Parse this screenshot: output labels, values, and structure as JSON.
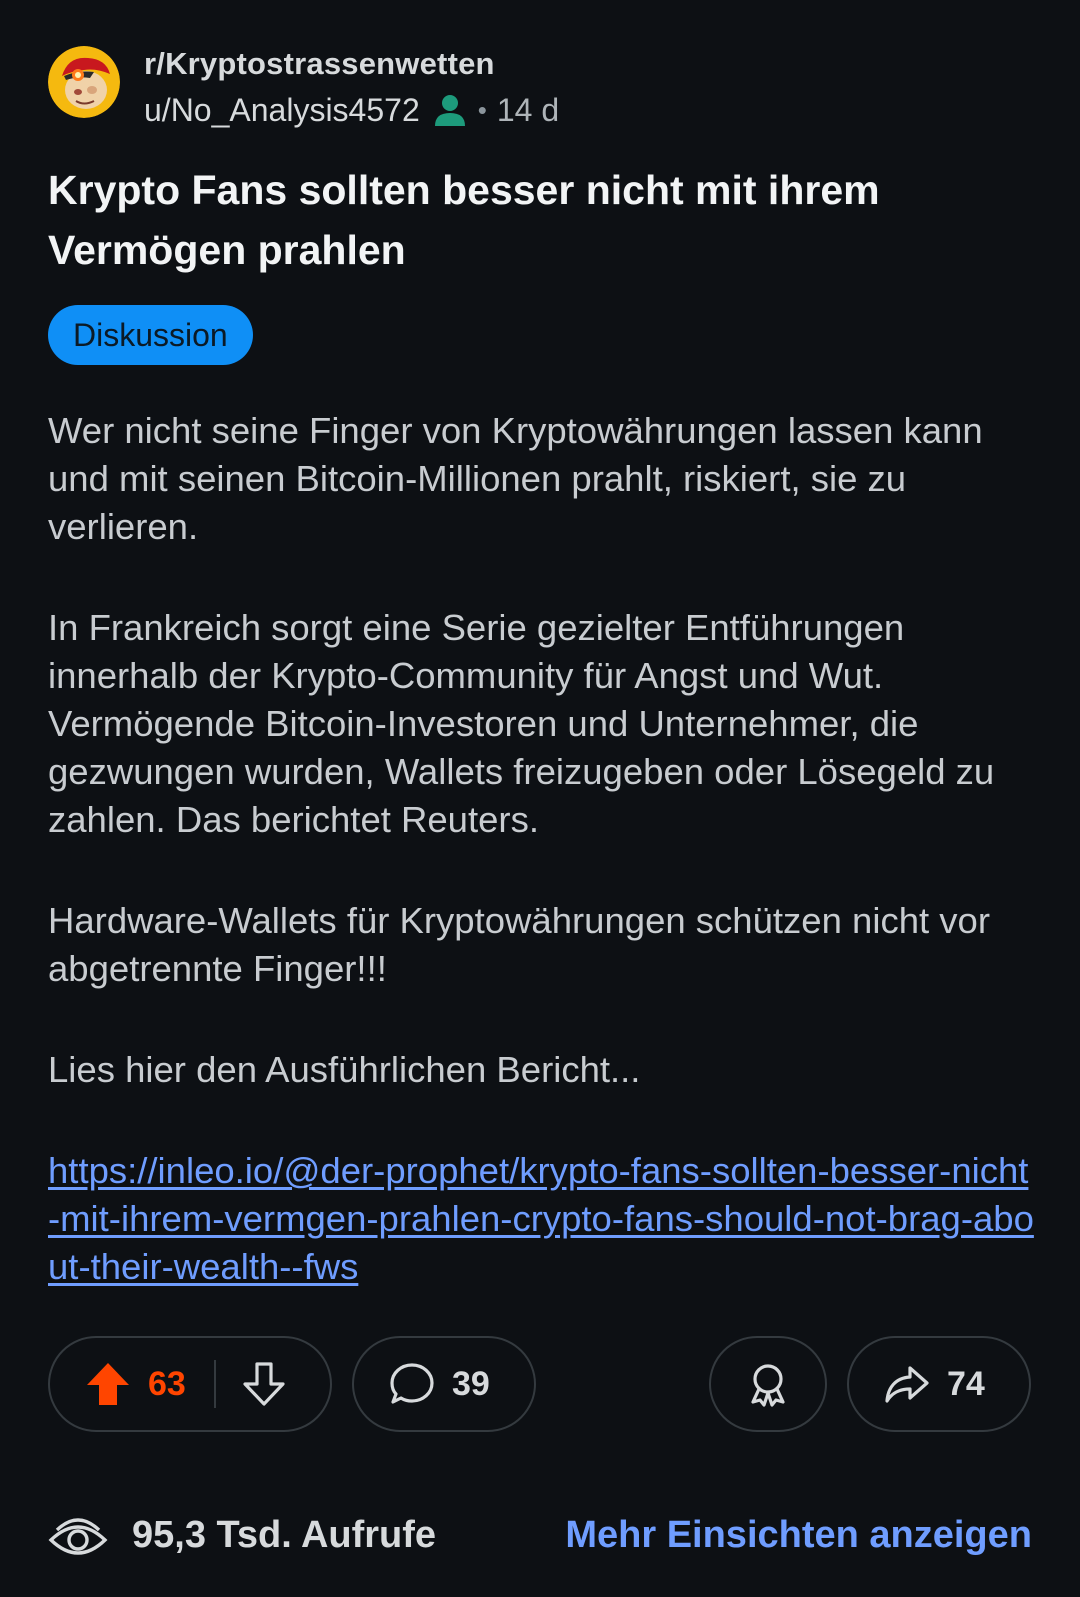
{
  "header": {
    "subreddit": "r/Kryptostrassenwetten",
    "username": "u/No_Analysis4572",
    "user_icon": "person-icon",
    "separator": "•",
    "age": "14 d"
  },
  "post": {
    "title": "Krypto Fans sollten besser nicht mit ihrem Vermögen prahlen",
    "flair": "Diskussion",
    "paragraphs": [
      "Wer nicht seine Finger von Kryptowährungen lassen kann und mit seinen Bitcoin-Millionen prahlt, riskiert, sie zu verlieren.",
      "In Frankreich sorgt eine Serie gezielter Entführungen innerhalb der Krypto-Community für Angst und Wut. Vermögende Bitcoin-Investoren und Unternehmer, die gezwungen wurden, Wallets freizugeben oder Lösegeld zu zahlen. Das berichtet Reuters.",
      "Hardware-Wallets für Kryptowährungen schützen nicht vor abgetrennte Finger!!!",
      "Lies hier den Ausführlichen Bericht..."
    ],
    "link": "https://inleo.io/@der-prophet/krypto-fans-sollten-besser-nicht-mit-ihrem-vermgen-prahlen-crypto-fans-should-not-brag-about-their-wealth--fws"
  },
  "actions": {
    "upvotes": "63",
    "comments": "39",
    "shares": "74",
    "upvote_color": "#ff4500"
  },
  "footer": {
    "views": "95,3 Tsd. Aufrufe",
    "insights": "Mehr Einsichten anzeigen"
  },
  "colors": {
    "background": "#0d1014",
    "flair": "#0f8ff6",
    "link": "#6f9dff",
    "user_icon": "#1d9b7c"
  }
}
